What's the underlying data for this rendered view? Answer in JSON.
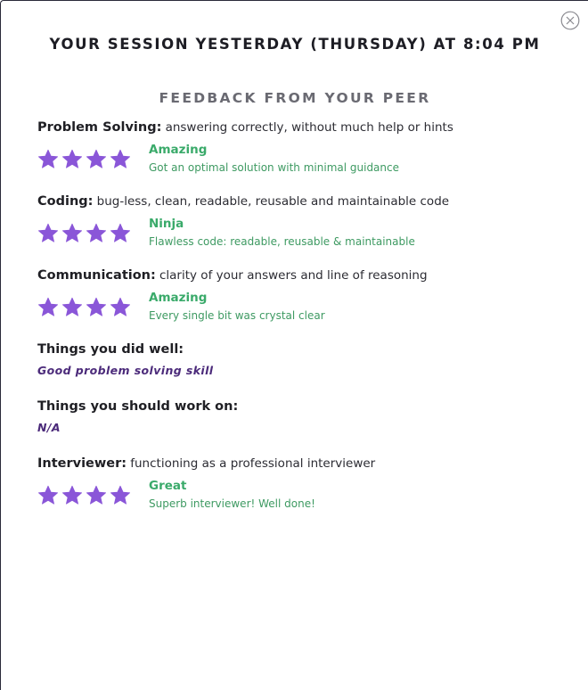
{
  "modal": {
    "close_icon": "close-circle-icon",
    "session_title": "YOUR SESSION YESTERDAY (THURSDAY) AT 8:04 PM",
    "section_title": "FEEDBACK FROM YOUR PEER"
  },
  "colors": {
    "star": "#8a56d8",
    "rating_label": "#3aaa6a",
    "rating_detail": "#3e9a62",
    "comment": "#4b2a7a"
  },
  "categories": [
    {
      "name": "Problem Solving:",
      "description": "answering correctly, without much help or hints",
      "stars": 4,
      "rating_label": "Amazing",
      "rating_detail": "Got an optimal solution with minimal guidance"
    },
    {
      "name": "Coding:",
      "description": "bug-less, clean, readable, reusable and maintainable code",
      "stars": 4,
      "rating_label": "Ninja",
      "rating_detail": "Flawless code: readable, reusable & maintainable"
    },
    {
      "name": "Communication:",
      "description": "clarity of your answers and line of reasoning",
      "stars": 4,
      "rating_label": "Amazing",
      "rating_detail": "Every single bit was crystal clear"
    }
  ],
  "did_well": {
    "title": "Things you did well:",
    "value": "Good problem solving skill"
  },
  "work_on": {
    "title": "Things you should work on:",
    "value": "N/A"
  },
  "interviewer": {
    "name": "Interviewer:",
    "description": "functioning as a professional interviewer",
    "stars": 4,
    "rating_label": "Great",
    "rating_detail": "Superb interviewer! Well done!"
  }
}
